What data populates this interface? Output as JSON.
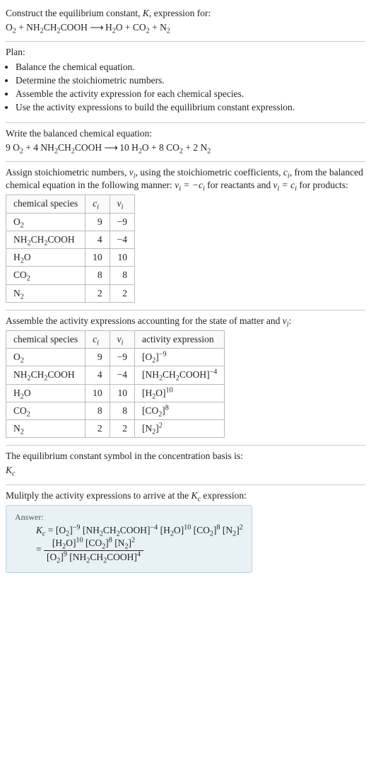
{
  "intro": {
    "line1_pre": "Construct the equilibrium constant, ",
    "K": "K",
    "line1_post": ", expression for:",
    "equation": "O₂ + NH₂CH₂COOH ⟶ H₂O + CO₂ + N₂"
  },
  "plan": {
    "header": "Plan:",
    "items": [
      "Balance the chemical equation.",
      "Determine the stoichiometric numbers.",
      "Assemble the activity expression for each chemical species.",
      "Use the activity expressions to build the equilibrium constant expression."
    ]
  },
  "balanced": {
    "header": "Write the balanced chemical equation:",
    "equation": "9 O₂ + 4 NH₂CH₂COOH ⟶ 10 H₂O + 8 CO₂ + 2 N₂"
  },
  "assign": {
    "text1": "Assign stoichiometric numbers, ",
    "nu_i": "νᵢ",
    "text2": ", using the stoichiometric coefficients, ",
    "c_i": "cᵢ",
    "text3": ", from the balanced chemical equation in the following manner: ",
    "rel_react": "νᵢ = −cᵢ",
    "text4": " for reactants and ",
    "rel_prod": "νᵢ = cᵢ",
    "text5": " for products:"
  },
  "table1": {
    "headers": {
      "species": "chemical species",
      "ci": "cᵢ",
      "nui": "νᵢ"
    },
    "rows": [
      {
        "species": "O₂",
        "ci": "9",
        "nui": "−9"
      },
      {
        "species": "NH₂CH₂COOH",
        "ci": "4",
        "nui": "−4"
      },
      {
        "species": "H₂O",
        "ci": "10",
        "nui": "10"
      },
      {
        "species": "CO₂",
        "ci": "8",
        "nui": "8"
      },
      {
        "species": "N₂",
        "ci": "2",
        "nui": "2"
      }
    ]
  },
  "assemble": {
    "text1": "Assemble the activity expressions accounting for the state of matter and ",
    "nu_i": "νᵢ",
    "text2": ":"
  },
  "table2": {
    "headers": {
      "species": "chemical species",
      "ci": "cᵢ",
      "nui": "νᵢ",
      "activity": "activity expression"
    },
    "rows": [
      {
        "species": "O₂",
        "ci": "9",
        "nui": "−9",
        "base": "[O₂]",
        "exp": "−9"
      },
      {
        "species": "NH₂CH₂COOH",
        "ci": "4",
        "nui": "−4",
        "base": "[NH₂CH₂COOH]",
        "exp": "−4"
      },
      {
        "species": "H₂O",
        "ci": "10",
        "nui": "10",
        "base": "[H₂O]",
        "exp": "10"
      },
      {
        "species": "CO₂",
        "ci": "8",
        "nui": "8",
        "base": "[CO₂]",
        "exp": "8"
      },
      {
        "species": "N₂",
        "ci": "2",
        "nui": "2",
        "base": "[N₂]",
        "exp": "2"
      }
    ]
  },
  "symbol": {
    "text": "The equilibrium constant symbol in the concentration basis is:",
    "Kc": "K꜀"
  },
  "multiply": {
    "text1": "Mulitply the activity expressions to arrive at the ",
    "Kc": "K꜀",
    "text2": " expression:"
  },
  "answer": {
    "label": "Answer:",
    "lhs": "K꜀ = ",
    "rhs_flat": "[O₂]⁻⁹ [NH₂CH₂COOH]⁻⁴ [H₂O]¹⁰ [CO₂]⁸ [N₂]²",
    "frac_top": "[H₂O]¹⁰ [CO₂]⁸ [N₂]²",
    "frac_bot": "[O₂]⁹ [NH₂CH₂COOH]⁴",
    "eq_sign": " = "
  }
}
